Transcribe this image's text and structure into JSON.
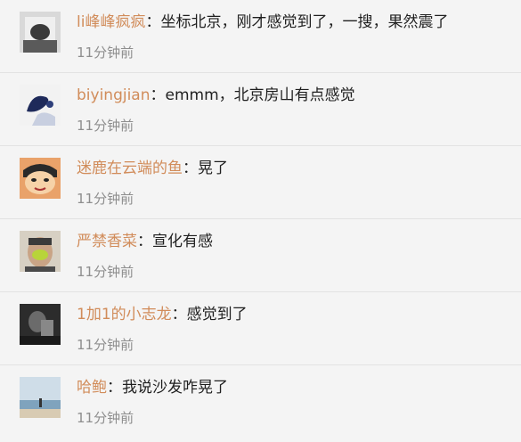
{
  "comments": [
    {
      "user": "li峰峰疯疯",
      "separator": "：",
      "text": "坐标北京，刚才感觉到了，一搜，果然震了",
      "time": "11分钟前",
      "avatar_icon": "user-avatar-icon"
    },
    {
      "user": "biyingjian",
      "separator": "：",
      "text": "emmm，北京房山有点感觉",
      "time": "11分钟前",
      "avatar_icon": "user-avatar-icon"
    },
    {
      "user": "迷鹿在云端的鱼",
      "separator": "：",
      "text": "晃了",
      "time": "11分钟前",
      "avatar_icon": "user-avatar-icon"
    },
    {
      "user": "严禁香菜",
      "separator": "：",
      "text": "宣化有感",
      "time": "11分钟前",
      "avatar_icon": "user-avatar-icon"
    },
    {
      "user": "1加1的小志龙",
      "separator": "：",
      "text": "感觉到了",
      "time": "11分钟前",
      "avatar_icon": "user-avatar-icon"
    },
    {
      "user": "哈鲍",
      "separator": "：",
      "text": "我说沙发咋晃了",
      "time": "11分钟前",
      "avatar_icon": "user-avatar-icon"
    }
  ],
  "colors": {
    "background": "#f4f4f4",
    "username": "#d18c5a",
    "text": "#1f1f1f",
    "time": "#8e8e8e",
    "divider": "#e2e2e2"
  }
}
